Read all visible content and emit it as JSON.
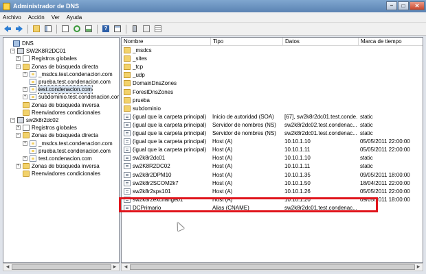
{
  "window": {
    "title": "Administrador de DNS"
  },
  "menu": [
    "Archivo",
    "Acción",
    "Ver",
    "Ayuda"
  ],
  "toolbar": {
    "buttons": [
      "back-arrow-icon",
      "forward-arrow-icon",
      "up-folder-icon",
      "show-hide-tree-icon",
      "export-list-icon",
      "refresh-icon",
      "properties-icon",
      "help-icon",
      "view-icon",
      "new-record-icon",
      "delete-icon",
      "list-icon"
    ]
  },
  "tree": [
    {
      "label": "DNS",
      "icon": "dns",
      "expander": ""
    },
    {
      "label": "SW2K8R2DC01",
      "icon": "server",
      "expander": "−"
    },
    {
      "label": "Registros globales",
      "icon": "log",
      "expander": "+"
    },
    {
      "label": "Zonas de búsqueda directa",
      "icon": "folder",
      "expander": "−"
    },
    {
      "label": "_msdcs.test.condenacion.com",
      "icon": "zone",
      "expander": "+"
    },
    {
      "label": "prueba.test.condenacion.com",
      "icon": "zone",
      "expander": ""
    },
    {
      "label": "test.condenacion.com",
      "icon": "zone",
      "expander": "+"
    },
    {
      "label": "subdominio.test.condenacion.com",
      "icon": "zone",
      "expander": "+"
    },
    {
      "label": "Zonas de búsqueda inversa",
      "icon": "folder",
      "expander": ""
    },
    {
      "label": "Reenviadores condicionales",
      "icon": "folder",
      "expander": ""
    },
    {
      "label": "sw2k8r2dc02",
      "icon": "server",
      "expander": "−"
    },
    {
      "label": "Registros globales",
      "icon": "log",
      "expander": "+"
    },
    {
      "label": "Zonas de búsqueda directa",
      "icon": "folder",
      "expander": "−"
    },
    {
      "label": "_msdcs.test.condenacion.com",
      "icon": "zone",
      "expander": "+"
    },
    {
      "label": "prueba.test.condenacion.com",
      "icon": "zone",
      "expander": ""
    },
    {
      "label": "test.condenacion.com",
      "icon": "zone",
      "expander": "+"
    },
    {
      "label": "Zonas de búsqueda inversa",
      "icon": "folder",
      "expander": "+"
    },
    {
      "label": "Reenviadores condicionales",
      "icon": "folder",
      "expander": ""
    }
  ],
  "tree_selected_index": 6,
  "columns": [
    "Nombre",
    "Tipo",
    "Datos",
    "Marca de tiempo"
  ],
  "rows": [
    {
      "icon": "folder",
      "name": "_msdcs",
      "type": "",
      "data": "",
      "time": ""
    },
    {
      "icon": "folder",
      "name": "_sites",
      "type": "",
      "data": "",
      "time": ""
    },
    {
      "icon": "folder",
      "name": "_tcp",
      "type": "",
      "data": "",
      "time": ""
    },
    {
      "icon": "folder",
      "name": "_udp",
      "type": "",
      "data": "",
      "time": ""
    },
    {
      "icon": "folder",
      "name": "DomainDnsZones",
      "type": "",
      "data": "",
      "time": ""
    },
    {
      "icon": "folder",
      "name": "ForestDnsZones",
      "type": "",
      "data": "",
      "time": ""
    },
    {
      "icon": "folder",
      "name": "prueba",
      "type": "",
      "data": "",
      "time": ""
    },
    {
      "icon": "folder",
      "name": "subdominio",
      "type": "",
      "data": "",
      "time": ""
    },
    {
      "icon": "record",
      "name": "(igual que la carpeta principal)",
      "type": "Inicio de autoridad (SOA)",
      "data": "[67], sw2k8r2dc01.test.conde...",
      "time": "static"
    },
    {
      "icon": "record",
      "name": "(igual que la carpeta principal)",
      "type": "Servidor de nombres (NS)",
      "data": "sw2k8r2dc02.test.condenac...",
      "time": "static"
    },
    {
      "icon": "record",
      "name": "(igual que la carpeta principal)",
      "type": "Servidor de nombres (NS)",
      "data": "sw2k8r2dc01.test.condenac...",
      "time": "static"
    },
    {
      "icon": "record",
      "name": "(igual que la carpeta principal)",
      "type": "Host (A)",
      "data": "10.10.1.10",
      "time": "05/05/2011 22:00:00"
    },
    {
      "icon": "record",
      "name": "(igual que la carpeta principal)",
      "type": "Host (A)",
      "data": "10.10.1.11",
      "time": "05/05/2011 22:00:00"
    },
    {
      "icon": "record",
      "name": "sw2k8r2dc01",
      "type": "Host (A)",
      "data": "10.10.1.10",
      "time": "static"
    },
    {
      "icon": "record",
      "name": "sw2K8R2DC02",
      "type": "Host (A)",
      "data": "10.10.1.11",
      "time": "static"
    },
    {
      "icon": "record",
      "name": "sw2k8r2DPM10",
      "type": "Host (A)",
      "data": "10.10.1.35",
      "time": "09/05/2011 18:00:00"
    },
    {
      "icon": "record",
      "name": "sw2k8r2SCOM2k7",
      "type": "Host (A)",
      "data": "10.10.1.50",
      "time": "18/04/2011 22:00:00"
    },
    {
      "icon": "record",
      "name": "sw2k8r2sps101",
      "type": "Host (A)",
      "data": "10.10.1.26",
      "time": "05/05/2011 22:00:00"
    },
    {
      "icon": "record",
      "name": "sw2k8r2exchange01",
      "type": "Host (A)",
      "data": "10.10.1.20",
      "time": "09/05/2011 18:00:00"
    },
    {
      "icon": "record",
      "name": "DCPrimario",
      "type": "Alias (CNAME)",
      "data": "sw2k8r2dc01.test.condenac...",
      "time": ""
    }
  ],
  "colors": {
    "title_bar": "#6b8fbf",
    "highlight": "#e0141b",
    "selection": "#d9e4f1"
  }
}
